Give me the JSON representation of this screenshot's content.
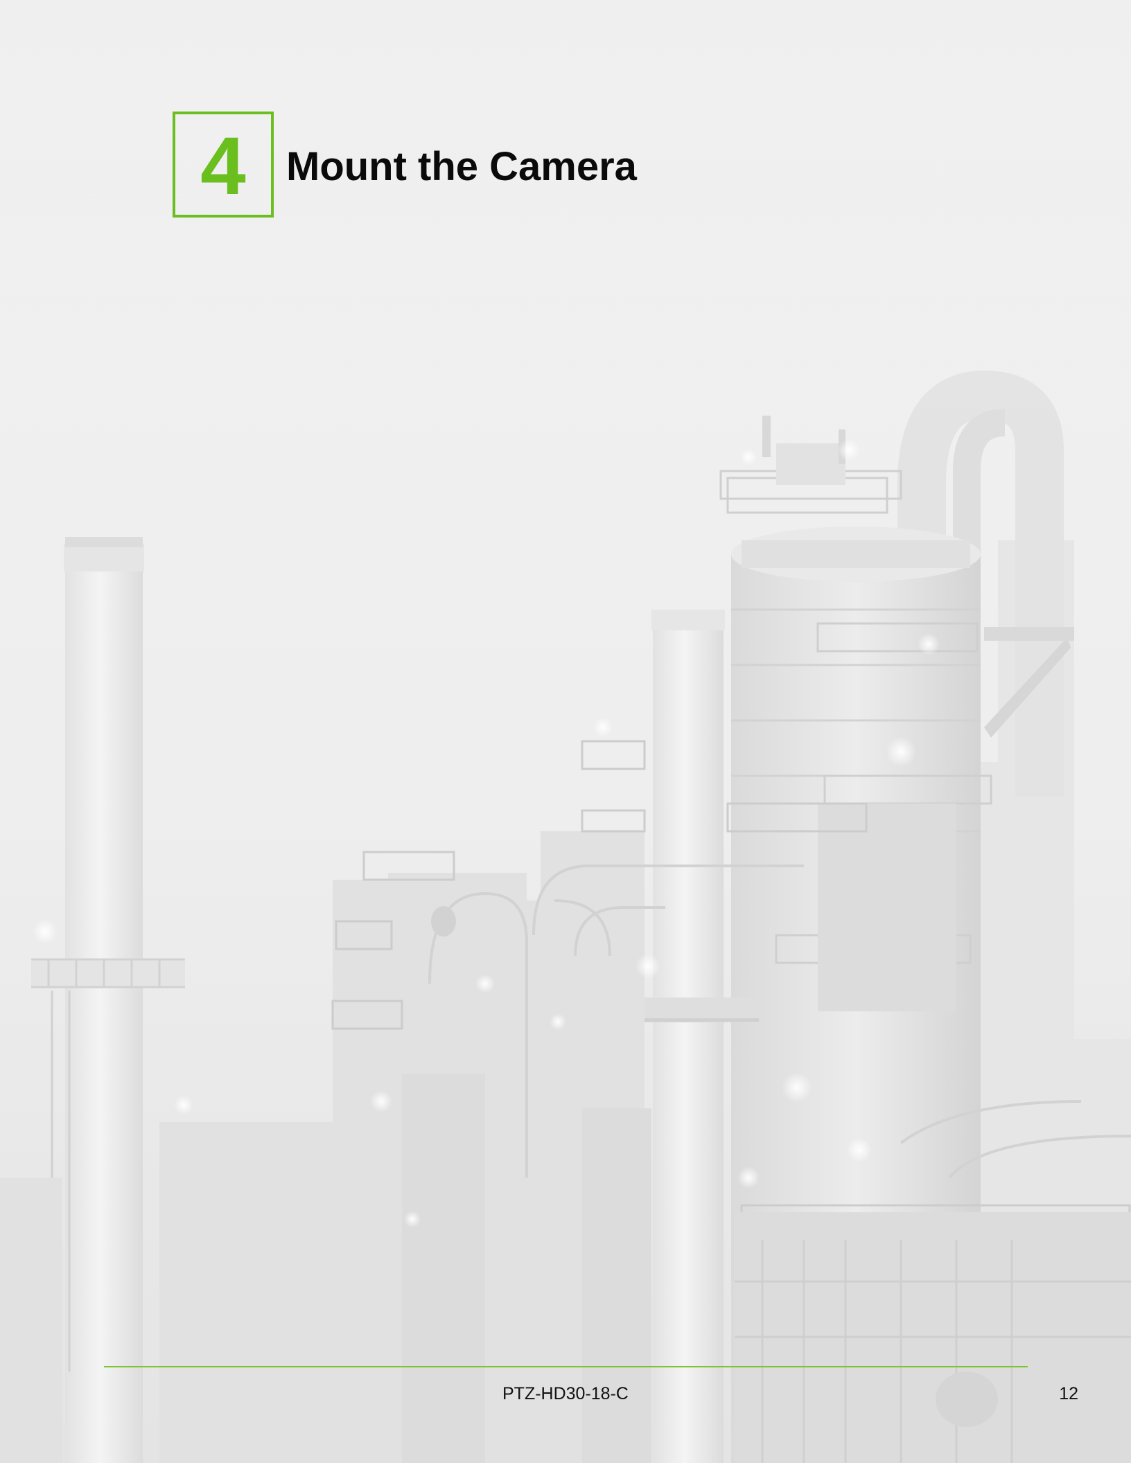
{
  "chapter": {
    "number": "4",
    "title": "Mount the Camera"
  },
  "footer": {
    "document_id": "PTZ-HD30-18-C",
    "page_number": "12"
  },
  "colors": {
    "accent": "#6abf1f",
    "rule": "#7cc532",
    "background": "#eeeeee"
  },
  "background_image": {
    "icon": "industrial-refinery-photo"
  }
}
